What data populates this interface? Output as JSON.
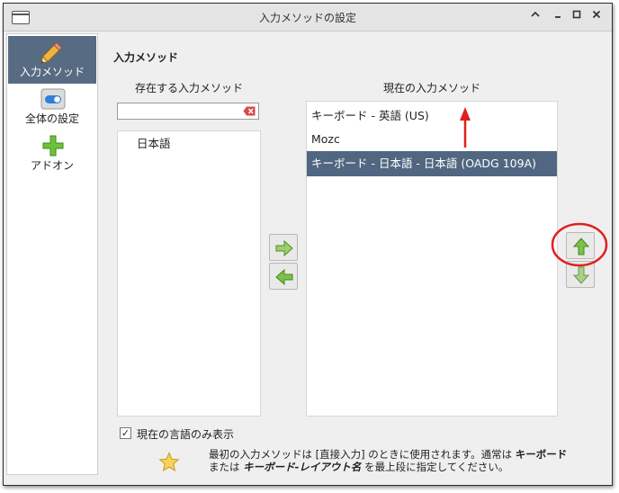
{
  "window": {
    "title": "入力メソッドの設定"
  },
  "sidebar": {
    "items": [
      {
        "label": "入力メソッド",
        "icon": "pencil-icon",
        "selected": true
      },
      {
        "label": "全体の設定",
        "icon": "toggle-icon",
        "selected": false
      },
      {
        "label": "アドオン",
        "icon": "plus-icon",
        "selected": false
      }
    ]
  },
  "main": {
    "section_title": "入力メソッド",
    "available": {
      "header": "存在する入力メソッド",
      "search_value": "",
      "items": [
        "日本語"
      ]
    },
    "current": {
      "header": "現在の入力メソッド",
      "items": [
        {
          "label": "キーボード - 英語 (US)",
          "selected": false
        },
        {
          "label": "Mozc",
          "selected": false
        },
        {
          "label": "キーボード - 日本語 - 日本語 (OADG 109A)",
          "selected": true
        }
      ]
    },
    "show_current_language_only": {
      "label": "現在の言語のみ表示",
      "checked": true
    },
    "hint": {
      "prefix": "最初の入力メソッドは [直接入力] のときに使用されます。通常は ",
      "bold1": "キーボード",
      "middle": " または ",
      "bold2": "キーボード-レイアウト名",
      "suffix": " を最上段に指定してください。"
    }
  },
  "colors": {
    "selection": "#516781",
    "annotation_red": "#e02020",
    "arrow_green": "#6cb13c"
  }
}
